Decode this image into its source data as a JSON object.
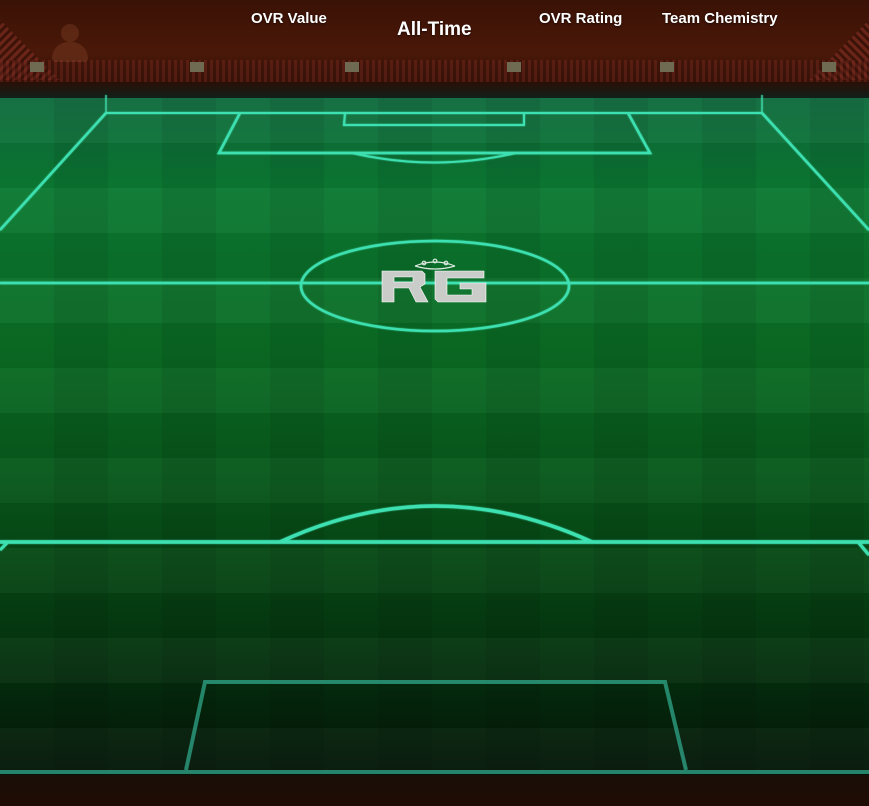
{
  "header": {
    "ovr_value_label": "OVR Value",
    "title": "All-Time",
    "ovr_rating_label": "OVR Rating",
    "team_chemistry_label": "Team Chemistry"
  },
  "pitch": {
    "logo_text": "RG",
    "line_color": "#3ee0b0",
    "grass_color": "#0a6d24"
  },
  "stadium": {
    "stand_color": "#4a1808"
  }
}
